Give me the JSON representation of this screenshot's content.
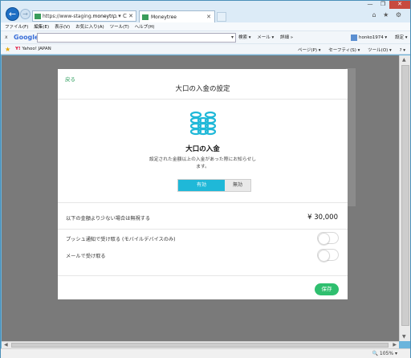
{
  "browser": {
    "url_prefix": "https://www-staging.",
    "url_domain": "moneytr...",
    "address_icons": "ρ ▾ C ✕",
    "tab_title": "Moneytree",
    "tab_close": "✕",
    "window_controls": [
      "—",
      "❐",
      "✕"
    ],
    "toolbar_icons": "⌂ ★ ⚙",
    "menu": [
      "ファイル(F)",
      "編集(E)",
      "表示(V)",
      "お気に入り(A)",
      "ツール(T)",
      "ヘルプ(H)"
    ],
    "google": {
      "close": "x",
      "logo": "Google",
      "dropdown": "▾",
      "search_label": "検索 ▾",
      "mail_label": "メール ▾",
      "more_label": "詳細 »",
      "user": "honko1974 ▾",
      "settings": "設定 ▾"
    },
    "favorites": {
      "item_logo": "Y!",
      "item": "Yahoo! JAPAN",
      "commands": [
        "ページ(P) ▾",
        "セーフティ(S) ▾",
        "ツール(O) ▾",
        "? ▾"
      ]
    },
    "zoom": "🔍 105% ▾"
  },
  "modal": {
    "back_label": "戻る",
    "title": "大口の入金の設定",
    "hero_title": "大口の入金",
    "hero_description": "設定された金額以上の入金があった際にお知らせします。",
    "toggle_on": "有効",
    "toggle_off": "無効",
    "threshold_label": "以下の金額より少ない場合は無視する",
    "threshold_value": "¥ 30,000",
    "push_label": "プッシュ通知で受け取る (モバイルデバイスのみ)",
    "email_label": "メールで受け取る",
    "save_label": "保存"
  },
  "colors": {
    "accent": "#1fb8d8",
    "save": "#2fbf6f",
    "back_link": "#2a9c5a",
    "overlay": "#7a7a7a"
  }
}
